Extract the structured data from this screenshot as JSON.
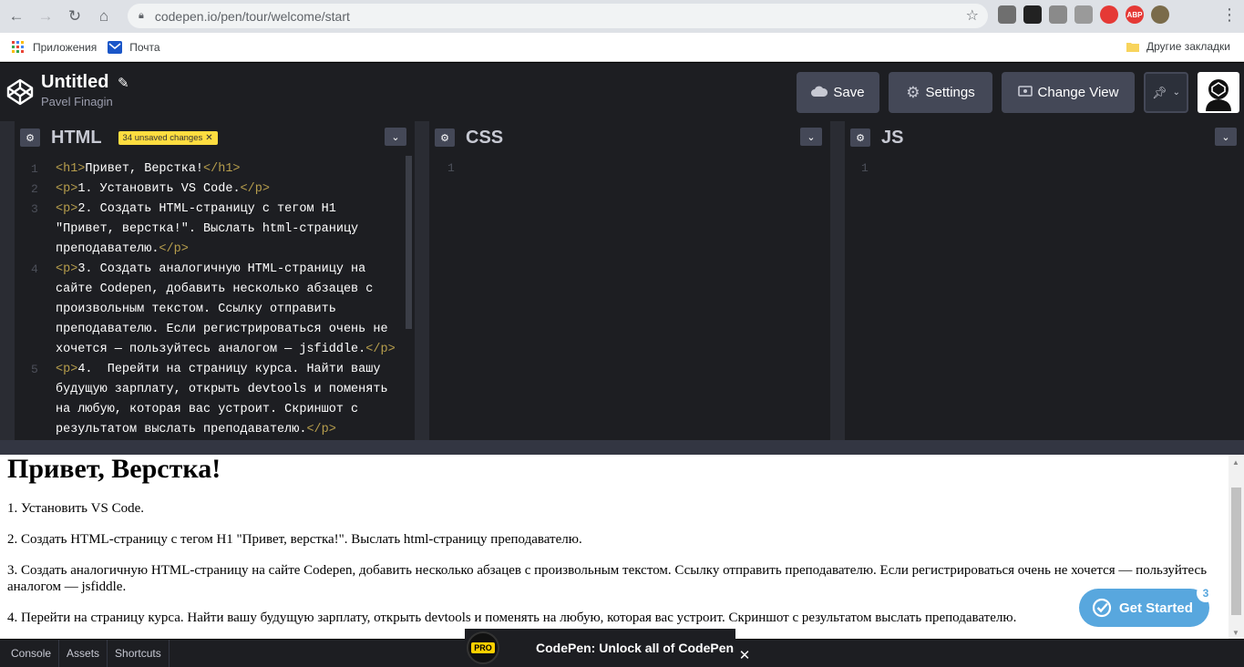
{
  "browser": {
    "url": "codepen.io/pen/tour/welcome/start",
    "bookmarks": [
      {
        "label": "Приложения",
        "icon": "apps-grid-icon"
      },
      {
        "label": "Почта",
        "icon": "mail-icon"
      }
    ],
    "other_bookmarks": "Другие закладки",
    "extensions": [
      {
        "name": "ext-gear-icon",
        "label": "",
        "color": "#6f6f6f"
      },
      {
        "name": "ext-cube-icon",
        "label": "",
        "color": "#222222"
      },
      {
        "name": "ext-shield-icon",
        "label": "",
        "color": "#8a8a8a"
      },
      {
        "name": "ext-user-icon",
        "label": "",
        "color": "#9a9a9a"
      },
      {
        "name": "ext-record-icon",
        "label": "",
        "color": "#e53935"
      },
      {
        "name": "ext-abp-icon",
        "label": "ABP",
        "color": "#e53935"
      },
      {
        "name": "ext-profile-icon",
        "label": "",
        "color": "#7a6b4a"
      }
    ]
  },
  "codepen": {
    "title": "Untitled",
    "author": "Pavel Finagin",
    "buttons": {
      "save": "Save",
      "settings": "Settings",
      "change_view": "Change View"
    },
    "editors": [
      {
        "title": "HTML",
        "badge": "34 unsaved changes",
        "lines": [
          {
            "n": "1",
            "parts": [
              {
                "t": "tag",
                "v": "<h1>"
              },
              {
                "t": "txt",
                "v": "Привет, Верстка!"
              },
              {
                "t": "tag",
                "v": "</h1>"
              }
            ]
          },
          {
            "n": "2",
            "parts": [
              {
                "t": "tag",
                "v": "<p>"
              },
              {
                "t": "txt",
                "v": "1. Установить VS Code."
              },
              {
                "t": "tag",
                "v": "</p>"
              }
            ]
          },
          {
            "n": "3",
            "parts": [
              {
                "t": "tag",
                "v": "<p>"
              },
              {
                "t": "txt",
                "v": "2. Создать HTML-страницу с тегом H1 \"Привет, верстка!\". Выслать html-страницу преподавателю."
              },
              {
                "t": "tag",
                "v": "</p>"
              }
            ]
          },
          {
            "n": "4",
            "parts": [
              {
                "t": "tag",
                "v": "<p>"
              },
              {
                "t": "txt",
                "v": "3. Создать аналогичную HTML-страницу на сайте Codepen, добавить несколько абзацев с произвольным текстом. Ссылку отправить преподавателю. Если регистрироваться очень не хочется — пользуйтесь аналогом — jsfiddle."
              },
              {
                "t": "tag",
                "v": "</p>"
              }
            ]
          },
          {
            "n": "5",
            "parts": [
              {
                "t": "tag",
                "v": "<p>"
              },
              {
                "t": "txt",
                "v": "4.  Перейти на страницу курса. Найти вашу будущую зарплату, открыть devtools и поменять на любую, которая вас устроит. Скриншот с результатом выслать преподавателю."
              },
              {
                "t": "tag",
                "v": "</p>"
              }
            ]
          }
        ]
      },
      {
        "title": "CSS",
        "line": "1"
      },
      {
        "title": "JS",
        "line": "1"
      }
    ],
    "preview": {
      "heading": "Привет, Верстка!",
      "paragraphs": [
        "1. Установить VS Code.",
        "2. Создать HTML-страницу с тегом H1 \"Привет, верстка!\". Выслать html-страницу преподавателю.",
        "3. Создать аналогичную HTML-страницу на сайте Codepen, добавить несколько абзацев с произвольным текстом. Ссылку отправить преподавателю. Если регистрироваться очень не хочется — пользуйтесь аналогом — jsfiddle.",
        "4. Перейти на страницу курса. Найти вашу будущую зарплату, открыть devtools и поменять на любую, которая вас устроит. Скриншот с результатом выслать преподавателю."
      ]
    },
    "footer": {
      "console": "Console",
      "assets": "Assets",
      "shortcuts": "Shortcuts"
    },
    "promo": {
      "badge": "PRO",
      "text": "CodePen: Unlock all of CodePen"
    },
    "get_started": {
      "label": "Get Started",
      "count": "3"
    }
  }
}
